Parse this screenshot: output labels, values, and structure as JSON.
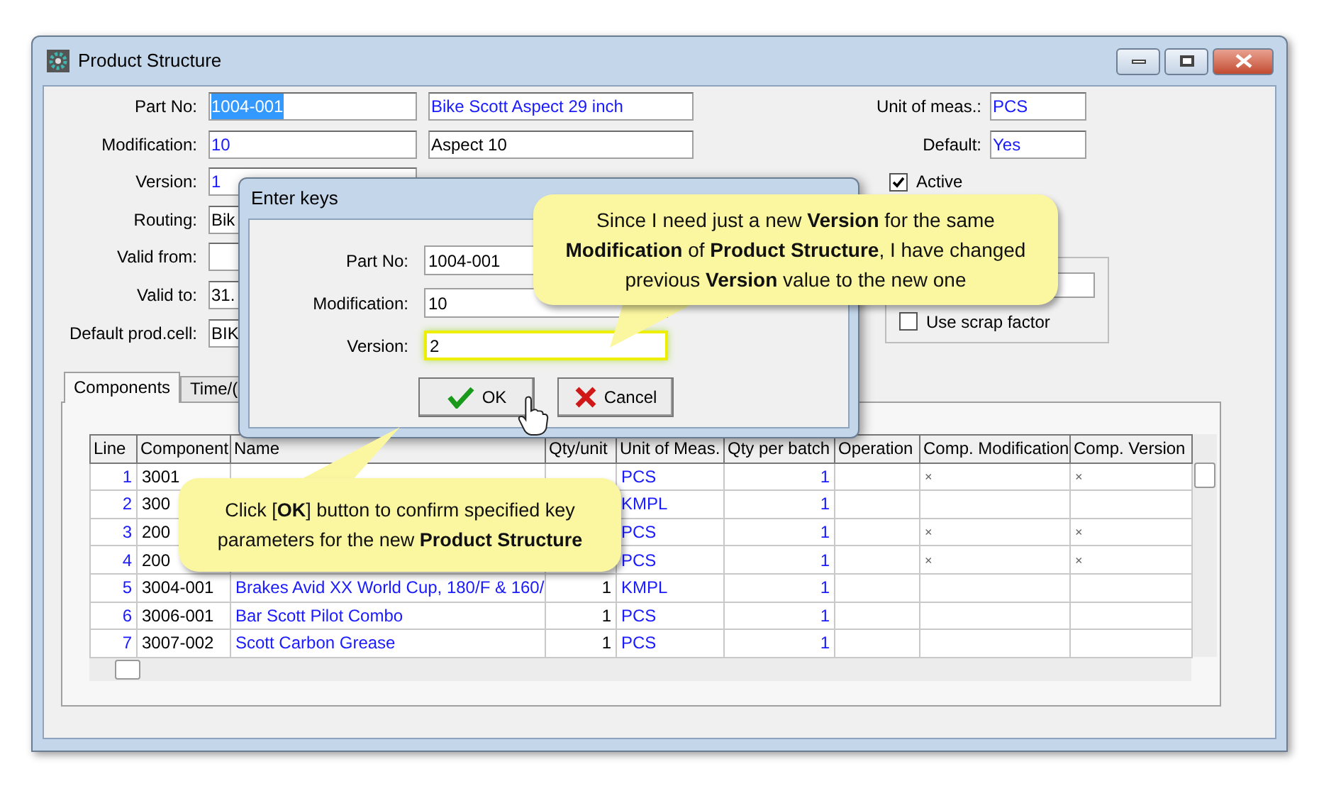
{
  "window": {
    "title": "Product Structure"
  },
  "fields": [
    {
      "label": "Part No:",
      "value": "1004-001",
      "kind": "selected",
      "description": {
        "value": "Bike Scott Aspect 29 inch",
        "kind": "lookup"
      }
    },
    {
      "label": "Modification:",
      "value": "10",
      "kind": "lookup",
      "description": {
        "value": "Aspect 10",
        "kind": "plain"
      }
    },
    {
      "label": "Version:",
      "value": "1",
      "kind": "lookup"
    },
    {
      "label": "Routing:",
      "value": "Bik",
      "kind": "plain"
    },
    {
      "label": "Valid from:"
    },
    {
      "label": "Valid to:",
      "value": "31.",
      "kind": "plain"
    },
    {
      "label": "Default prod.cell:",
      "value": "BIK",
      "kind": "plain"
    }
  ],
  "side_fields": [
    {
      "label": "Unit of meas.:",
      "value": "PCS",
      "kind": "lookup"
    },
    {
      "label": "Default:",
      "value": "Yes",
      "kind": "lookup"
    }
  ],
  "active": {
    "label": "Active",
    "checked": true
  },
  "scrap": {
    "label": "Use scrap factor",
    "checked": false
  },
  "tabs": [
    {
      "label": "Components",
      "selected": true
    },
    {
      "label": "Time/(",
      "selected": false
    }
  ],
  "table": {
    "columns": [
      "Line",
      "Component",
      "Name",
      "Qty/unit",
      "Unit of Meas.",
      "Qty per batch",
      "Operation",
      "Comp. Modification",
      "Comp. Version"
    ],
    "rows": [
      {
        "line": "1",
        "component": "3001",
        "unit": "PCS",
        "batch": "1",
        "comp_modification": "×",
        "comp_version": "×"
      },
      {
        "line": "2",
        "component": "300",
        "unit": "KMPL",
        "batch": "1"
      },
      {
        "line": "3",
        "component": "200",
        "unit": "PCS",
        "batch": "1",
        "comp_modification": "×",
        "comp_version": "×"
      },
      {
        "line": "4",
        "component": "200",
        "unit": "PCS",
        "batch": "1",
        "comp_modification": "×",
        "comp_version": "×"
      },
      {
        "line": "5",
        "component": "3004-001",
        "name": "Brakes Avid XX World Cup, 180/F & 160/",
        "qty": "1",
        "unit": "KMPL",
        "batch": "1"
      },
      {
        "line": "6",
        "component": "3006-001",
        "name": "Bar Scott Pilot Combo",
        "qty": "1",
        "unit": "PCS",
        "batch": "1"
      },
      {
        "line": "7",
        "component": "3007-002",
        "name": "Scott Carbon Grease",
        "qty": "1",
        "unit": "PCS",
        "batch": "1"
      }
    ]
  },
  "dialog": {
    "title": "Enter keys",
    "fields": [
      {
        "label": "Part No:",
        "value": "1004-001",
        "focused": false
      },
      {
        "label": "Modification:",
        "value": "10",
        "focused": false
      },
      {
        "label": "Version:",
        "value": "2",
        "focused": true
      }
    ],
    "buttons": [
      {
        "label": "OK",
        "kind": "ok"
      },
      {
        "label": "Cancel",
        "kind": "cancel"
      }
    ]
  },
  "callouts": [
    {
      "text": "Since I need just a new **Version** for the same **Modification** of **Product Structure**, I have changed previous **Version** value to the new one"
    },
    {
      "text": "Click [**OK**] button to confirm specified key parameters for the new **Product Structure**"
    }
  ]
}
